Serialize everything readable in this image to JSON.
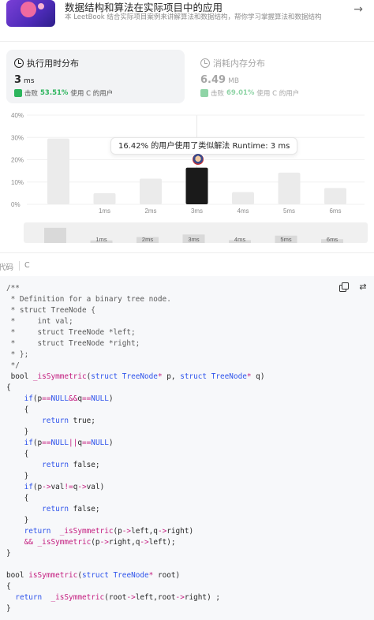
{
  "book": {
    "title": "数据结构和算法在实际项目中的应用",
    "description": "本 LeetBook 结合实际项目案例来讲解算法和数据结构，帮你学习掌握算法和数据结构",
    "arrow": "→"
  },
  "runtime_card": {
    "title": "执行用时分布",
    "value": "3",
    "unit": "ms",
    "beat_prefix": "击败",
    "beat_percent": "53.51%",
    "beat_suffix": "使用 C 的用户"
  },
  "memory_card": {
    "title": "消耗内存分布",
    "value": "6.49",
    "unit": "MB",
    "beat_prefix": "击败",
    "beat_percent": "69.01%",
    "beat_suffix": "使用 C 的用户"
  },
  "tooltip": "16.42% 的用户使用了类似解法 Runtime: 3 ms",
  "colors": {
    "highlight_bar": "#1a1a1a",
    "bar": "#ebebeb",
    "green": "#2db55d"
  },
  "chart_data": {
    "type": "bar",
    "categories": [
      "",
      "1ms",
      "2ms",
      "3ms",
      "4ms",
      "5ms",
      "6ms"
    ],
    "values": [
      29.5,
      5,
      11.5,
      16.42,
      5.5,
      14.2,
      7.3
    ],
    "highlight_index": 3,
    "y_ticks": [
      "0%",
      "10%",
      "20%",
      "30%",
      "40%"
    ],
    "ylim": [
      0,
      40
    ],
    "grid": true
  },
  "mini_chart": {
    "labels": [
      "",
      "1ms",
      "2ms",
      "3ms",
      "4ms",
      "5ms",
      "6ms"
    ],
    "values": [
      29.5,
      5,
      11.5,
      16.42,
      5.5,
      14.2,
      7.3
    ]
  },
  "code_tabs": {
    "first": "代码",
    "second": "C"
  },
  "code_tools": {
    "copy": "copy-icon",
    "swap": "swap-icon"
  }
}
